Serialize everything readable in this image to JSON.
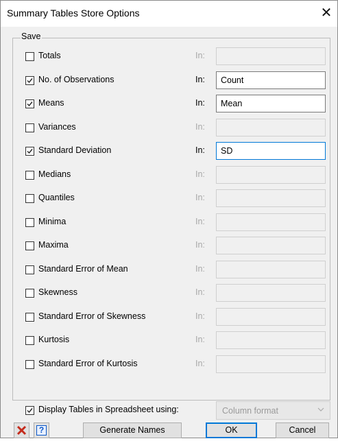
{
  "window": {
    "title": "Summary Tables Store Options",
    "close_glyph": "✕"
  },
  "group": {
    "label": "Save"
  },
  "in_label": "In:",
  "options": [
    {
      "label": "Totals",
      "checked": false,
      "value": ""
    },
    {
      "label": "No. of Observations",
      "checked": true,
      "value": "Count"
    },
    {
      "label": "Means",
      "checked": true,
      "value": "Mean"
    },
    {
      "label": "Variances",
      "checked": false,
      "value": ""
    },
    {
      "label": "Standard Deviation",
      "checked": true,
      "value": "SD"
    },
    {
      "label": "Medians",
      "checked": false,
      "value": ""
    },
    {
      "label": "Quantiles",
      "checked": false,
      "value": ""
    },
    {
      "label": "Minima",
      "checked": false,
      "value": ""
    },
    {
      "label": "Maxima",
      "checked": false,
      "value": ""
    },
    {
      "label": "Standard Error of Mean",
      "checked": false,
      "value": ""
    },
    {
      "label": "Skewness",
      "checked": false,
      "value": ""
    },
    {
      "label": "Standard Error of Skewness",
      "checked": false,
      "value": ""
    },
    {
      "label": "Kurtosis",
      "checked": false,
      "value": ""
    },
    {
      "label": "Standard Error of Kurtosis",
      "checked": false,
      "value": ""
    }
  ],
  "display": {
    "label": "Display Tables in Spreadsheet using:",
    "checked": true,
    "format_value": "Column format"
  },
  "buttons": {
    "generate": "Generate Names",
    "ok": "OK",
    "cancel": "Cancel",
    "help_glyph": "?"
  },
  "colors": {
    "accent": "#0078d7",
    "cancel_icon": "#c42b1c",
    "help_icon": "#0a57c8"
  }
}
